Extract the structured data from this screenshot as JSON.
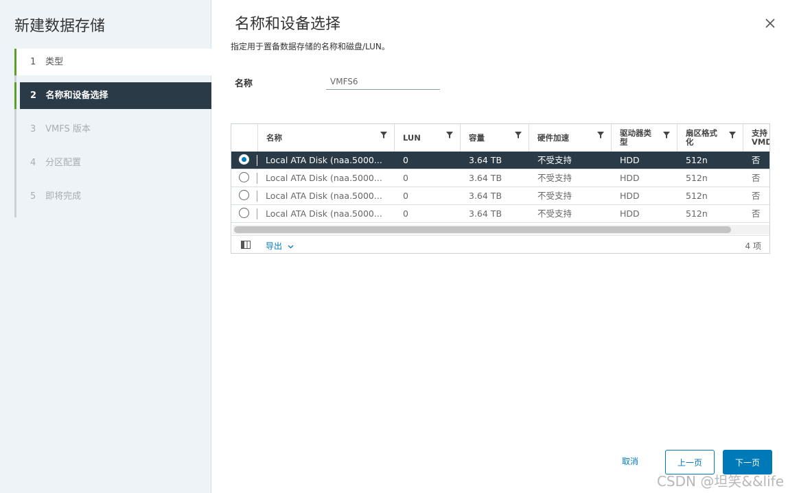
{
  "sidebar": {
    "title": "新建数据存储",
    "steps": [
      {
        "num": "1",
        "label": "类型"
      },
      {
        "num": "2",
        "label": "名称和设备选择"
      },
      {
        "num": "3",
        "label": "VMFS 版本"
      },
      {
        "num": "4",
        "label": "分区配置"
      },
      {
        "num": "5",
        "label": "即将完成"
      }
    ]
  },
  "main": {
    "title": "名称和设备选择",
    "subtitle": "指定用于置备数据存储的名称和磁盘/LUN。",
    "name_label": "名称",
    "name_value": "VMFS6"
  },
  "grid": {
    "columns": [
      "名称",
      "LUN",
      "容量",
      "硬件加速",
      "驱动器类型",
      "扇区格式化",
      "支持 VMD"
    ],
    "rows": [
      {
        "name": "Local ATA Disk (naa.5000...",
        "lun": "0",
        "capacity": "3.64 TB",
        "hw_accel": "不受支持",
        "drive_type": "HDD",
        "sector": "512n",
        "vmd": "否",
        "selected": true
      },
      {
        "name": "Local ATA Disk (naa.5000...",
        "lun": "0",
        "capacity": "3.64 TB",
        "hw_accel": "不受支持",
        "drive_type": "HDD",
        "sector": "512n",
        "vmd": "否",
        "selected": false
      },
      {
        "name": "Local ATA Disk (naa.5000...",
        "lun": "0",
        "capacity": "3.64 TB",
        "hw_accel": "不受支持",
        "drive_type": "HDD",
        "sector": "512n",
        "vmd": "否",
        "selected": false
      },
      {
        "name": "Local ATA Disk (naa.5000...",
        "lun": "0",
        "capacity": "3.64 TB",
        "hw_accel": "不受支持",
        "drive_type": "HDD",
        "sector": "512n",
        "vmd": "否",
        "selected": false
      }
    ],
    "export_label": "导出",
    "count": "4 项"
  },
  "footer": {
    "cancel": "取消",
    "prev": "上一页",
    "next": "下一页"
  },
  "watermark": "CSDN @坦笑&&life",
  "colors": {
    "accent": "#0079b8",
    "selected_row": "#2a3b47",
    "step_done_bar": "#5b9e2a"
  }
}
